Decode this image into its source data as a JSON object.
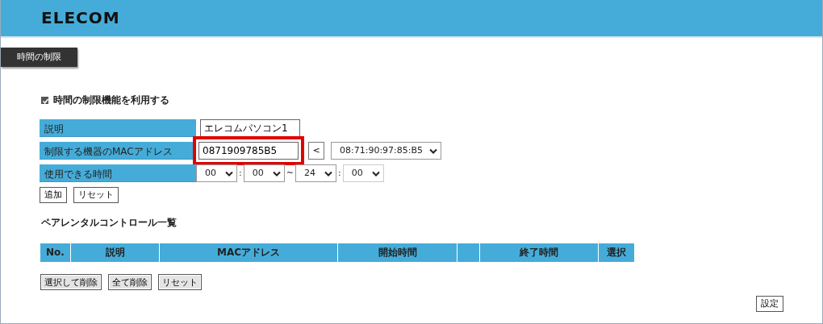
{
  "header": {
    "logo": "ELECOM"
  },
  "tabs": [
    {
      "label": "時間の制限",
      "selected": true
    }
  ],
  "enable": {
    "label": "時間の制限機能を利用する",
    "checked": true
  },
  "form": {
    "rows": [
      {
        "label": "説明",
        "kind": "text",
        "value": "エレコムパソコン1",
        "highlighted": false
      },
      {
        "label": "制限する機器のMACアドレス",
        "kind": "mac",
        "value": "0871909785B5",
        "highlighted": true,
        "copy_button": "<",
        "device": "08:71:90:97:85:B5"
      },
      {
        "label": "使用できる時間",
        "kind": "time",
        "start_hour": "00",
        "start_minute": "00",
        "separator": "~",
        "end_hour": "24",
        "end_minute": "00",
        "colon": ":"
      }
    ],
    "buttons": [
      "追加",
      "リセット"
    ]
  },
  "list": {
    "title": "ペアレンタルコントロール一覧",
    "columns": [
      "No.",
      "説明",
      "MACアドレス",
      "開始時間",
      "",
      "終了時間",
      "選択"
    ],
    "buttons": [
      "選択して削除",
      "全て削除",
      "リセット"
    ]
  },
  "save_button": "設定"
}
